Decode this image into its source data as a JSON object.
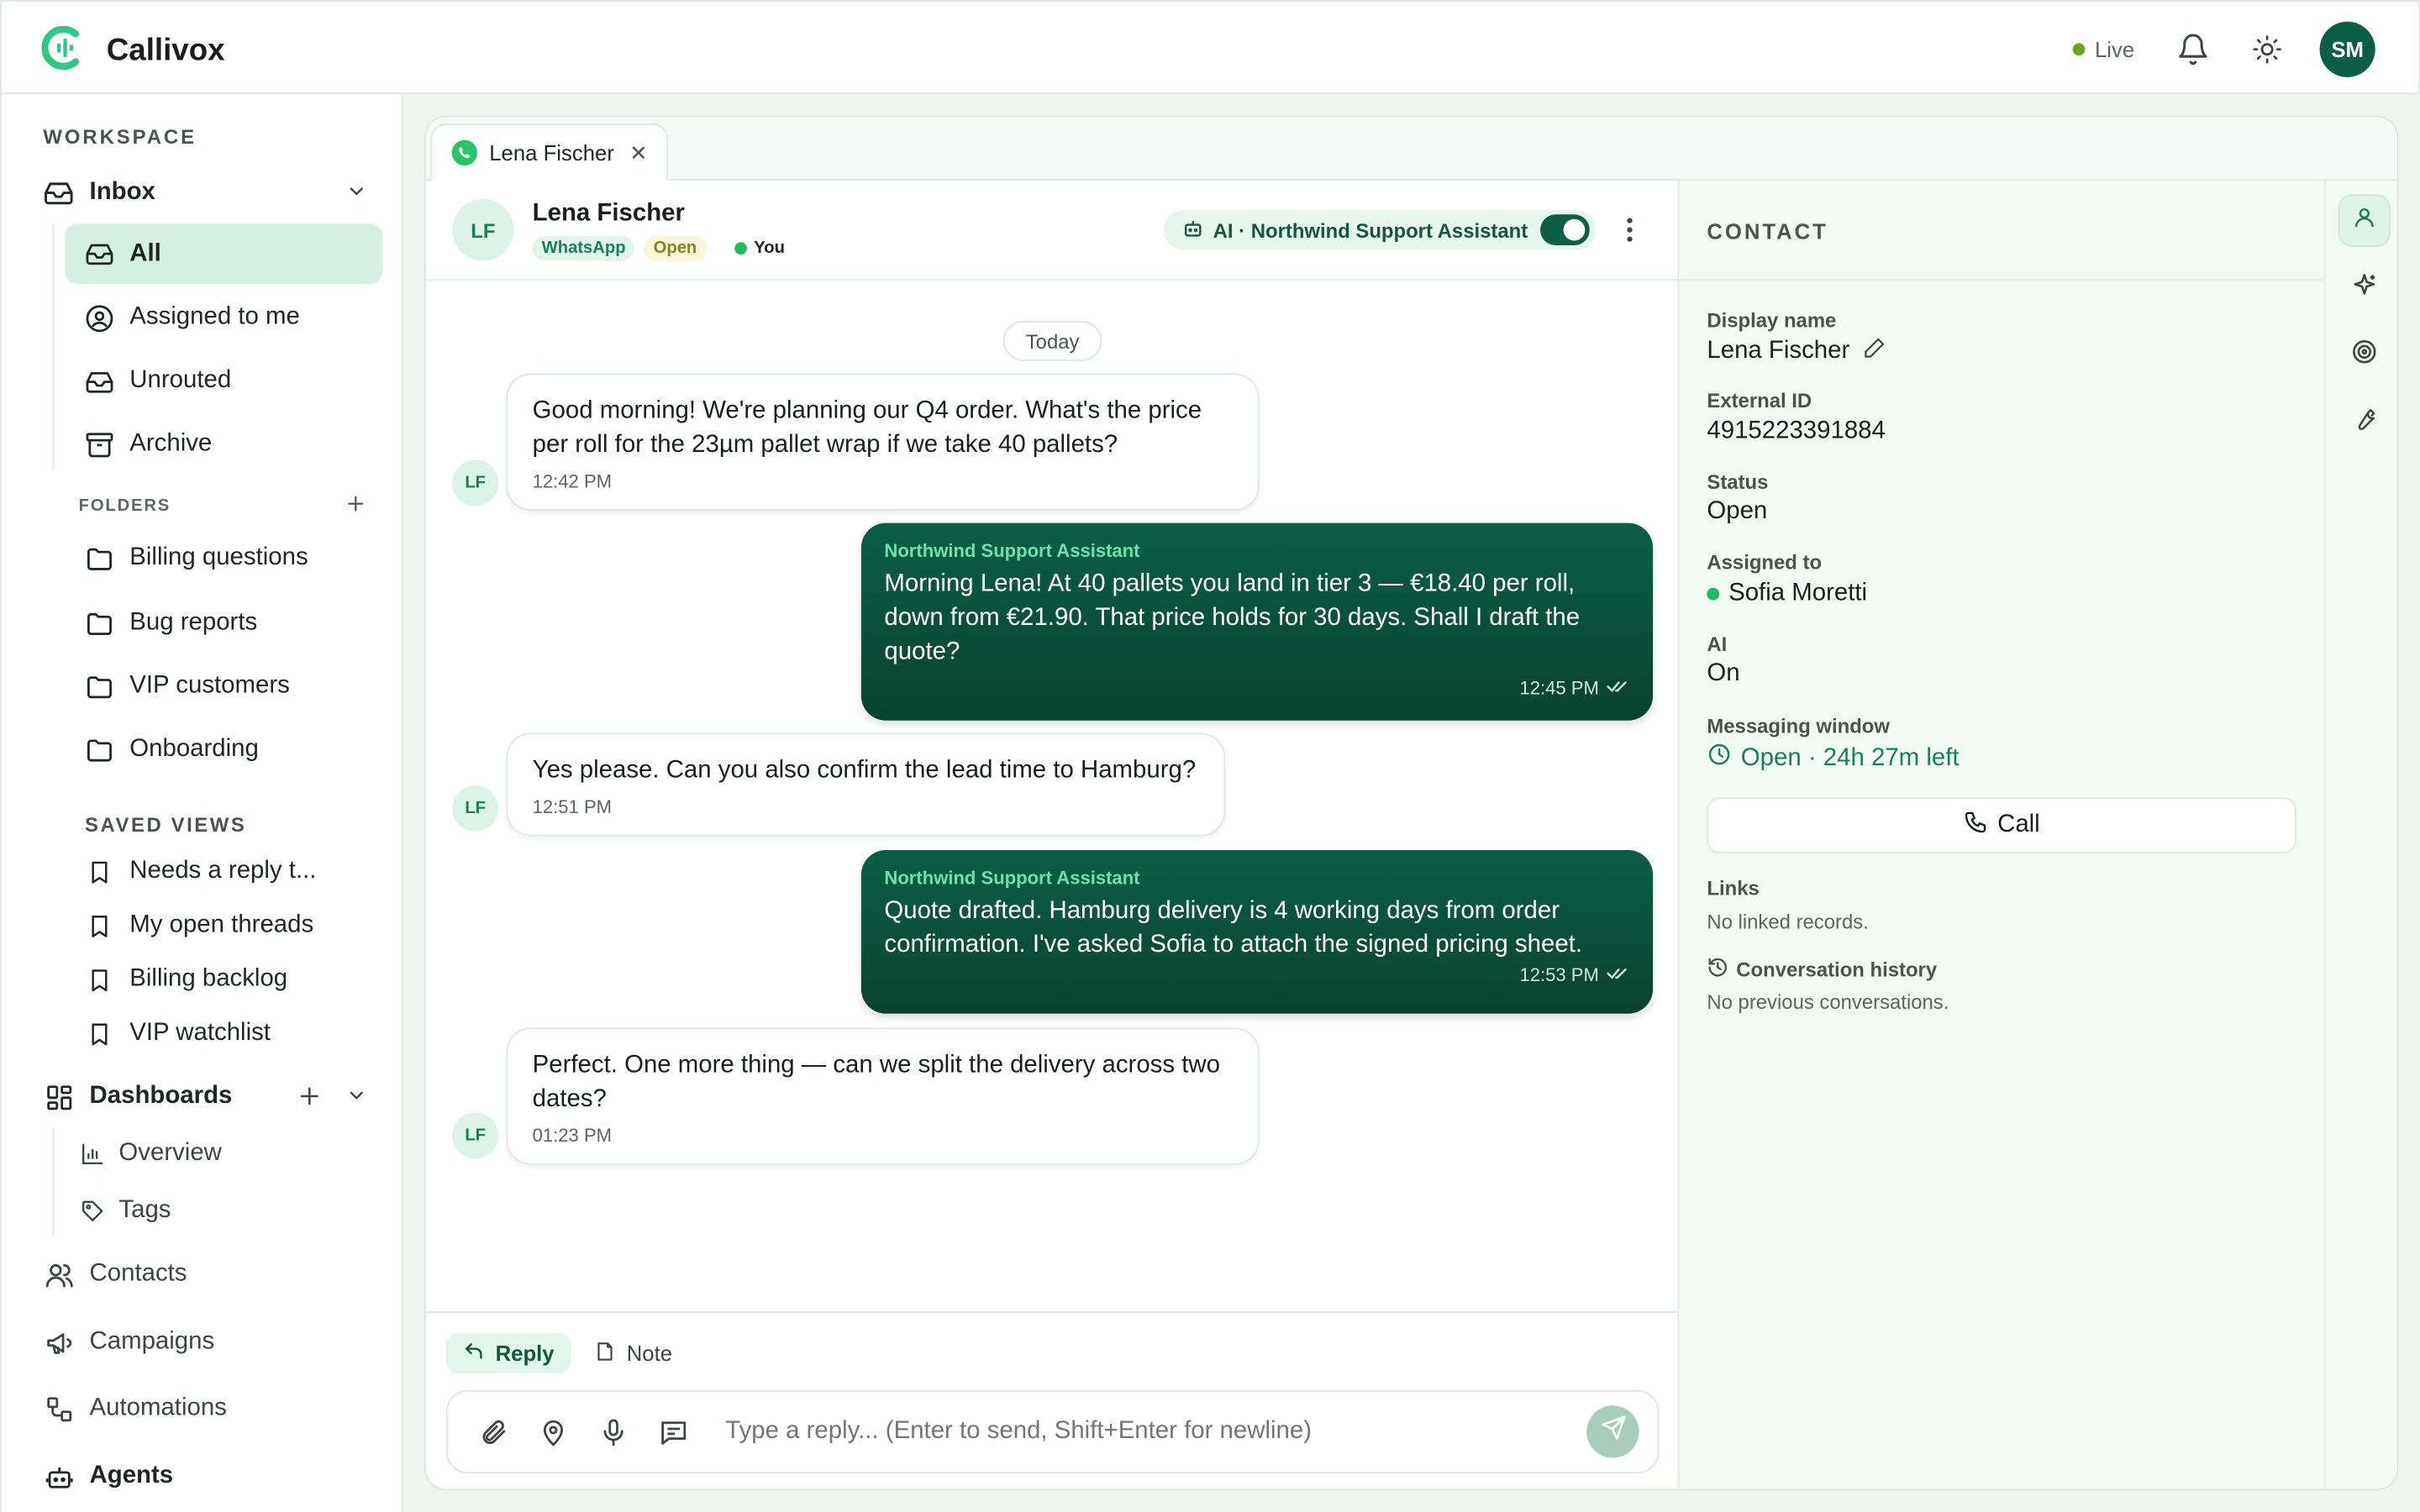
{
  "app": {
    "name": "Callivox",
    "live_label": "Live",
    "user_initials": "SM"
  },
  "colors": {
    "accent": "#0b5f45",
    "accent_light": "#d6efe3",
    "online": "#1dbb62",
    "live": "#6aa628"
  },
  "sidebar": {
    "workspace_label": "WORKSPACE",
    "inbox": {
      "label": "Inbox",
      "items": [
        {
          "label": "All",
          "icon": "inbox-icon",
          "active": true
        },
        {
          "label": "Assigned to me",
          "icon": "user-circle-icon"
        },
        {
          "label": "Unrouted",
          "icon": "inbox-icon"
        },
        {
          "label": "Archive",
          "icon": "archive-icon"
        }
      ]
    },
    "folders_label": "FOLDERS",
    "folders": [
      "Billing questions",
      "Bug reports",
      "VIP customers",
      "Onboarding"
    ],
    "saved_views_label": "SAVED VIEWS",
    "saved_views": [
      "Needs a reply t...",
      "My open threads",
      "Billing backlog",
      "VIP watchlist"
    ],
    "dashboards": {
      "label": "Dashboards",
      "items": [
        "Overview",
        "Tags"
      ]
    },
    "nav": [
      "Contacts",
      "Campaigns",
      "Automations",
      "Agents"
    ]
  },
  "tab": {
    "label": "Lena Fischer"
  },
  "conversation": {
    "contact_initials": "LF",
    "contact_name": "Lena Fischer",
    "channel_badge": "WhatsApp",
    "status_badge": "Open",
    "assignee_badge": "You",
    "ai_label": "AI · Northwind Support Assistant",
    "date_divider": "Today",
    "messages": [
      {
        "direction": "in",
        "text": "Good morning! We're planning our Q4 order. What's the price per roll for the 23µm pallet wrap if we take 40 pallets?",
        "time": "12:42 PM"
      },
      {
        "direction": "out",
        "sender": "Northwind Support Assistant",
        "text": "Morning Lena! At 40 pallets you land in tier 3 — €18.40 per roll, down from €21.90. That price holds for 30 days. Shall I draft the quote?",
        "time": "12:45 PM"
      },
      {
        "direction": "in",
        "text": "Yes please. Can you also confirm the lead time to Hamburg?",
        "time": "12:51 PM"
      },
      {
        "direction": "out",
        "sender": "Northwind Support Assistant",
        "text": "Quote drafted. Hamburg delivery is 4 working days from order confirmation. I've asked Sofia to attach the signed pricing sheet.",
        "time": "12:53 PM"
      },
      {
        "direction": "in",
        "text": "Perfect. One more thing — can we split the delivery across two dates?",
        "time": "01:23 PM"
      }
    ]
  },
  "composer": {
    "reply_label": "Reply",
    "note_label": "Note",
    "placeholder": "Type a reply... (Enter to send, Shift+Enter for newline)"
  },
  "contact_panel": {
    "title": "CONTACT",
    "display_name_label": "Display name",
    "display_name": "Lena Fischer",
    "external_id_label": "External ID",
    "external_id": "4915223391884",
    "status_label": "Status",
    "status": "Open",
    "assigned_label": "Assigned to",
    "assigned": "Sofia Moretti",
    "ai_label": "AI",
    "ai_value": "On",
    "window_label": "Messaging window",
    "window_value": "Open · 24h 27m left",
    "call_label": "Call",
    "links_label": "Links",
    "links_value": "No linked records.",
    "history_label": "Conversation history",
    "history_value": "No previous conversations."
  }
}
